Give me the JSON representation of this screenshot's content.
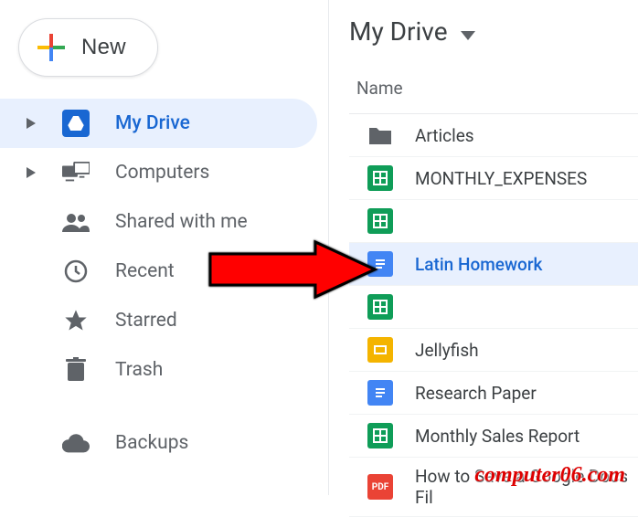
{
  "sidebar": {
    "new_label": "New",
    "items": [
      {
        "label": "My Drive",
        "icon": "drive",
        "selected": true,
        "expandable": true
      },
      {
        "label": "Computers",
        "icon": "computers",
        "selected": false,
        "expandable": true
      },
      {
        "label": "Shared with me",
        "icon": "shared",
        "selected": false,
        "expandable": false
      },
      {
        "label": "Recent",
        "icon": "recent",
        "selected": false,
        "expandable": false
      },
      {
        "label": "Starred",
        "icon": "starred",
        "selected": false,
        "expandable": false
      },
      {
        "label": "Trash",
        "icon": "trash",
        "selected": false,
        "expandable": false
      },
      {
        "label": "Backups",
        "icon": "backups",
        "selected": false,
        "expandable": false
      }
    ]
  },
  "breadcrumb": {
    "title": "My Drive"
  },
  "list": {
    "header_name": "Name",
    "files": [
      {
        "name": "Articles",
        "type": "folder",
        "selected": false
      },
      {
        "name": "MONTHLY_EXPENSES",
        "type": "sheets",
        "selected": false
      },
      {
        "name": "",
        "type": "sheets",
        "selected": false
      },
      {
        "name": "Latin Homework",
        "type": "docs",
        "selected": true
      },
      {
        "name": "",
        "type": "sheets",
        "selected": false
      },
      {
        "name": "Jellyfish",
        "type": "slides",
        "selected": false
      },
      {
        "name": "Research Paper",
        "type": "docs",
        "selected": false
      },
      {
        "name": "Monthly Sales Report",
        "type": "sheets",
        "selected": false
      },
      {
        "name": "How to Save a Google Docs Fil",
        "type": "pdf",
        "selected": false
      }
    ]
  },
  "watermark": "computer06.com"
}
